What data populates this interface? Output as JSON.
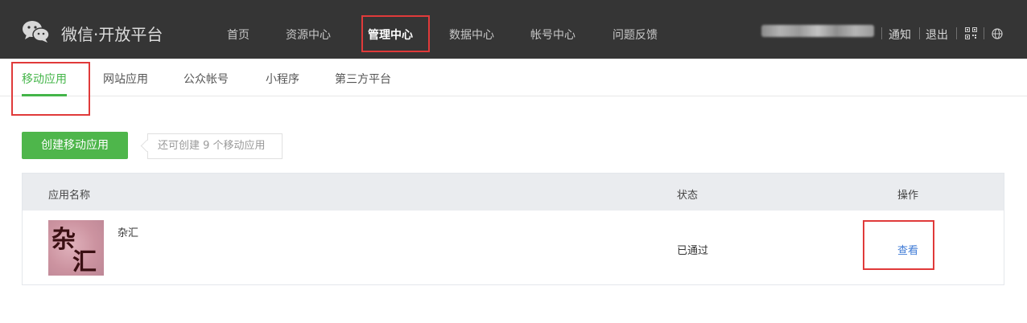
{
  "topbar": {
    "brand": "微信·开放平台",
    "nav": [
      "首页",
      "资源中心",
      "管理中心",
      "数据中心",
      "帐号中心",
      "问题反馈"
    ],
    "active_nav": "管理中心",
    "links": {
      "notify": "通知",
      "logout": "退出"
    }
  },
  "subnav": {
    "tabs": [
      "移动应用",
      "网站应用",
      "公众帐号",
      "小程序",
      "第三方平台"
    ],
    "active": "移动应用"
  },
  "create": {
    "button": "创建移动应用",
    "hint": "还可创建 9 个移动应用"
  },
  "table": {
    "headers": {
      "name": "应用名称",
      "status": "状态",
      "action": "操作"
    },
    "rows": [
      {
        "name": "杂汇",
        "icon_text": "杂汇",
        "status": "已通过",
        "action": "查看"
      }
    ]
  },
  "colors": {
    "accent": "#44b549",
    "topbar": "#353535",
    "link": "#3f7bd6",
    "highlight": "#e03a3a"
  }
}
